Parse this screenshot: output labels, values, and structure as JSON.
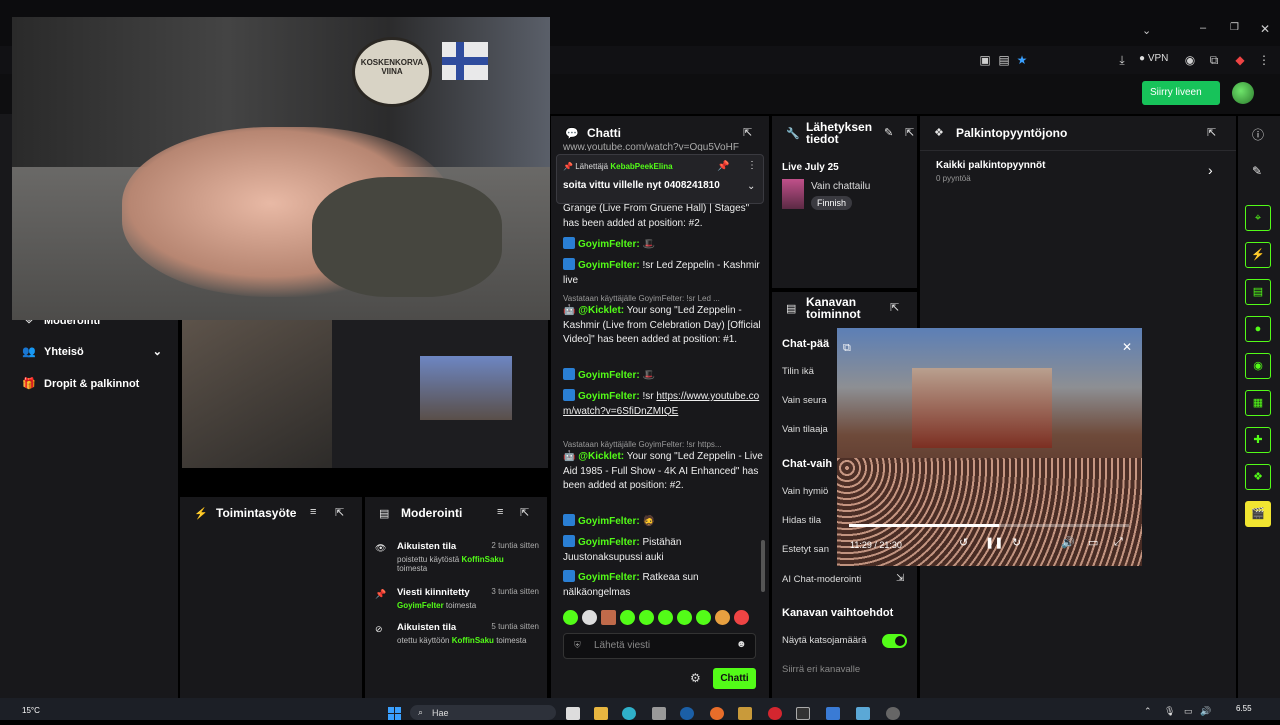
{
  "browser": {
    "vpn_label": "VPN"
  },
  "header": {
    "go_live_label": "Siirry liveen"
  },
  "left_nav": {
    "items": [
      {
        "label": "Moderointi"
      },
      {
        "label": "Yhteisö"
      },
      {
        "label": "Dropit & palkinnot"
      }
    ]
  },
  "webcam": {
    "sign_text": "KOSKENKORVA VIINA"
  },
  "chat": {
    "title": "Chatti",
    "pinned": {
      "prefix": "Lähettäjä",
      "user": "KebabPeekElina",
      "text": "soita vittu villelle nyt 0408241810"
    },
    "partial_top": "www.youtube.com/watch?v=Oqu5VoHF",
    "messages": [
      {
        "user": "",
        "text": "Grange (Live From Gruene Hall) | Stages\" has been added at position: #2."
      },
      {
        "user": "GoyimFelter:",
        "text": ""
      },
      {
        "user": "GoyimFelter:",
        "text": "!sr Led Zeppelin - Kashmir live"
      },
      {
        "reply": "Vastataan käyttäjälle GoyimFelter: !sr Led ..."
      },
      {
        "user": "@Kicklet:",
        "text": "Your song \"Led Zeppelin - Kashmir (Live from Celebration Day) [Official Video]\" has been added at position: #1."
      },
      {
        "user": "GoyimFelter:",
        "text": ""
      },
      {
        "user": "GoyimFelter:",
        "text": "!sr",
        "link": "https://www.youtube.com/watch?v=6SfiDnZMIQE"
      },
      {
        "reply": "Vastataan käyttäjälle GoyimFelter: !sr https..."
      },
      {
        "user": "@Kicklet:",
        "text": "Your song \"Led Zeppelin - Live Aid 1985 - Full Show - 4K AI Enhanced\" has been added at position: #2."
      },
      {
        "user": "GoyimFelter:",
        "text": ""
      },
      {
        "user": "GoyimFelter:",
        "text": "Pistähän Juustonaksupussi auki"
      },
      {
        "user": "GoyimFelter:",
        "text": "Ratkeaa sun nälkäongelmas"
      }
    ],
    "input_placeholder": "Lähetä viesti",
    "send_label": "Chatti"
  },
  "stream_info": {
    "title": "Lähetyksen tiedot",
    "date": "Live July 25",
    "category": "Vain chattailu",
    "tag": "Finnish"
  },
  "channel_actions": {
    "title": "Kanavan toiminnot",
    "section1": "Chat-pää",
    "rows1": [
      "Tilin ikä",
      "Vain seura",
      "Vain tilaaja"
    ],
    "section2": "Chat-vaih",
    "rows2": [
      "Vain hymiö",
      "Hidas tila",
      "Estetyt san"
    ],
    "ai_mod": "AI Chat-moderointi",
    "section3": "Kanavan vaihtoehdot",
    "viewer_count_label": "Näytä katsojamäärä",
    "viewer_count_on": true,
    "host_label": "Siirrä eri kanavalle"
  },
  "rewards": {
    "title": "Palkintopyyntöjono",
    "all_label": "Kaikki palkintopyynnöt",
    "count": "0 pyyntöä"
  },
  "activity": {
    "title": "Toimintasyöte"
  },
  "moderation": {
    "title": "Moderointi",
    "entries": [
      {
        "title": "Aikuisten tila",
        "time": "2 tuntia sitten",
        "pre": "poistettu käytöstä",
        "user": "KoffinSaku",
        "post": "toimesta"
      },
      {
        "title": "Viesti kiinnitetty",
        "time": "3 tuntia sitten",
        "pre": "",
        "user": "GoyimFelter",
        "post": "toimesta"
      },
      {
        "title": "Aikuisten tila",
        "time": "5 tuntia sitten",
        "pre": "otettu käyttöön",
        "user": "KoffinSaku",
        "post": "toimesta"
      }
    ]
  },
  "video": {
    "time": "11:29 / 21:30",
    "progress": 0.535
  },
  "taskbar": {
    "weather": "15°C",
    "search_label": "Hae",
    "clock": "6.55"
  }
}
